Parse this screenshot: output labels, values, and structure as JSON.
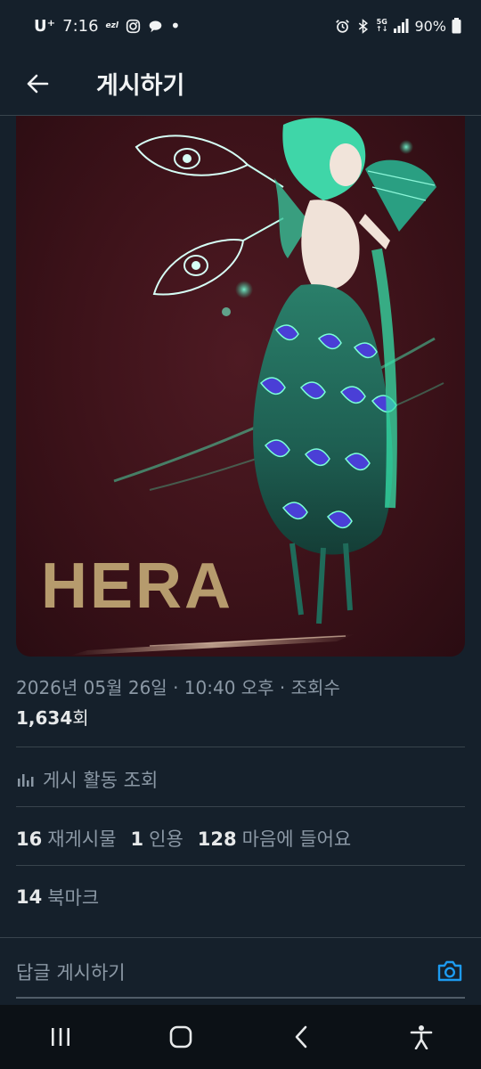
{
  "status_bar": {
    "carrier": "U⁺",
    "time": "7:16",
    "app_label": "ezl",
    "battery": "90%",
    "network_tag_top": "5G",
    "network_tag_bottom": "↑↓"
  },
  "header": {
    "title": "게시하기"
  },
  "media": {
    "artwork_text": "HERA",
    "alt_icon": "peacock-fairy-illustration"
  },
  "meta": {
    "date_line": "2026년 05월 26일 · 10:40 오후 · 조회수",
    "views_count": "1,634",
    "views_suffix": "회"
  },
  "activity": {
    "label": "게시 활동 조회"
  },
  "stats": {
    "reposts_count": "16",
    "reposts_label": "재게시물",
    "quotes_count": "1",
    "quotes_label": "인용",
    "likes_count": "128",
    "likes_label": "마음에 들어요"
  },
  "bookmarks": {
    "count": "14",
    "label": "북마크"
  },
  "reply": {
    "placeholder": "답글 게시하기"
  },
  "colors": {
    "background": "#15202b",
    "accent": "#1d9bf0",
    "muted": "#8b98a5"
  }
}
